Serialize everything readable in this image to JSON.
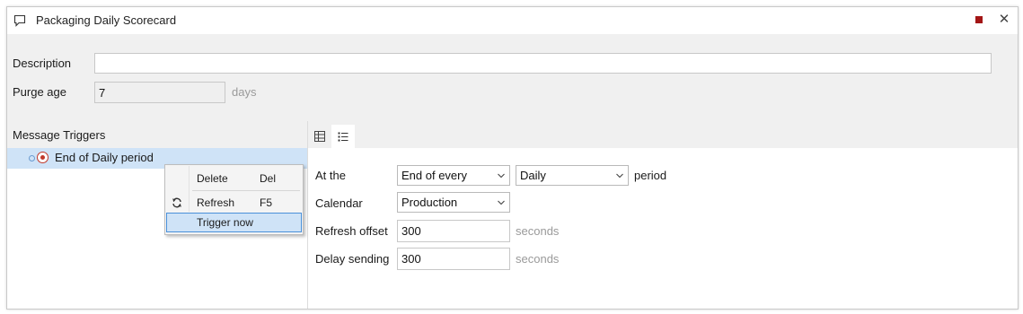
{
  "window": {
    "title": "Packaging Daily Scorecard",
    "title_icon": "speech-bubble-icon",
    "stop_icon": "stop-square-icon",
    "close_icon": "close-icon",
    "close_glyph": "✕",
    "stop_color": "#a31515"
  },
  "form": {
    "description_label": "Description",
    "description_value": "",
    "purge_age_label": "Purge age",
    "purge_age_value": "7",
    "purge_age_suffix": "days"
  },
  "triggers_panel": {
    "title": "Message Triggers",
    "items": [
      {
        "label": "End of Daily period",
        "icon": "radio-target-icon",
        "selected": true
      }
    ]
  },
  "context_menu": {
    "items": [
      {
        "label": "Delete",
        "shortcut": "Del",
        "icon": ""
      },
      {
        "label": "Refresh",
        "shortcut": "F5",
        "icon": "refresh-icon"
      },
      {
        "label": "Trigger now",
        "shortcut": "",
        "icon": "",
        "highlighted": true
      }
    ]
  },
  "detail_tabs": [
    {
      "icon": "table-icon",
      "active": false
    },
    {
      "icon": "list-icon",
      "active": true
    }
  ],
  "detail": {
    "at_the_label": "At the",
    "at_the_value": "End of every",
    "period_value": "Daily",
    "period_suffix": "period",
    "calendar_label": "Calendar",
    "calendar_value": "Production",
    "refresh_offset_label": "Refresh offset",
    "refresh_offset_value": "300",
    "refresh_offset_suffix": "seconds",
    "delay_sending_label": "Delay sending",
    "delay_sending_value": "300",
    "delay_sending_suffix": "seconds"
  },
  "colors": {
    "selection": "#cfe3f7",
    "accent": "#4a90d9",
    "panel_bg": "#f0f0f0",
    "trigger_red": "#c0392b"
  }
}
